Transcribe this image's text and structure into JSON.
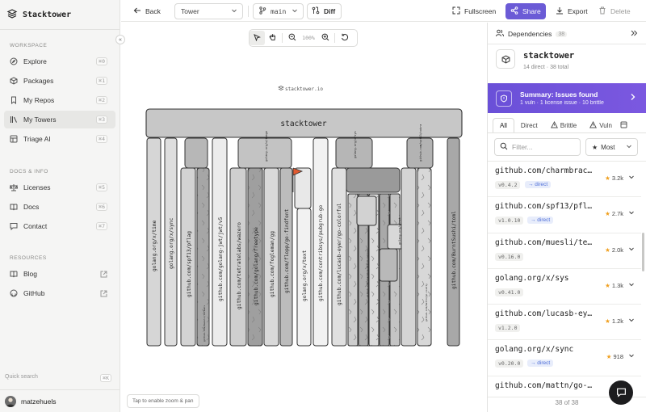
{
  "brand": {
    "name": "Stacktower"
  },
  "sidebar": {
    "sections": [
      {
        "title": "Workspace",
        "items": [
          {
            "label": "Explore",
            "kbd": "⌘0",
            "icon": "compass-icon"
          },
          {
            "label": "Packages",
            "kbd": "⌘1",
            "icon": "package-icon"
          },
          {
            "label": "My Repos",
            "kbd": "⌘2",
            "icon": "bookmark-icon"
          },
          {
            "label": "My Towers",
            "kbd": "⌘3",
            "icon": "library-icon",
            "active": true
          },
          {
            "label": "Triage AI",
            "kbd": "⌘4",
            "icon": "triage-icon"
          }
        ]
      },
      {
        "title": "Docs & Info",
        "items": [
          {
            "label": "Licenses",
            "kbd": "⌘5",
            "icon": "scale-icon"
          },
          {
            "label": "Docs",
            "kbd": "⌘6",
            "icon": "book-icon"
          },
          {
            "label": "Contact",
            "kbd": "⌘7",
            "icon": "message-icon"
          }
        ]
      },
      {
        "title": "Resources",
        "items": [
          {
            "label": "Blog",
            "icon": "blog-icon"
          },
          {
            "label": "GitHub",
            "icon": "github-icon"
          }
        ]
      }
    ],
    "quick_search": {
      "label": "Quick search",
      "kbd": "⌘K"
    },
    "user": {
      "name": "matzehuels"
    }
  },
  "topbar": {
    "back": "Back",
    "view_select": "Tower",
    "branch": "main",
    "diff": "Diff",
    "fullscreen": "Fullscreen",
    "share": "Share",
    "export": "Export",
    "delete": "Delete"
  },
  "canvas": {
    "zoom": "100%",
    "tap_hint": "Tap  to enable zoom & pan",
    "watermark": "stacktower.io",
    "root_label": "stacktower",
    "labels": [
      "golang.org/x/time",
      "golang.org/x/sync",
      "github.com/spf13/pflag",
      "github.com/muesli/termenv",
      "github.com/golang-jwt/jwt/v5",
      "github.com/tetratelabs/wazero",
      "github.com/golang/freetype",
      "github.com/fogleman/gg",
      "github.com/flopp/go-findfont",
      "golang.org/x/text",
      "github.com/contribsys/pubgrub-go",
      "github.com/lucasb-eyer/go-colorful",
      "github.com/mattn/go-isatty",
      "github.com/BurntSushi/toml",
      "golang.org/x/image",
      "golang.org/x/sys",
      "golang.org/x/net",
      "github.com/charmbracelet/lipgloss",
      "github.com/spf13/cobra"
    ]
  },
  "panel": {
    "title": "Dependencies",
    "count": "38",
    "package": {
      "name": "stacktower",
      "sub": "14 direct · 38 total"
    },
    "summary": {
      "title": "Summary: Issues found",
      "sub": "1 vuln · 1 license issue · 10 brittle"
    },
    "tabs": [
      "All",
      "Direct",
      "Brittle",
      "Vuln"
    ],
    "filter_placeholder": "Filter...",
    "sort": "Most",
    "deps": [
      {
        "name": "github.com/charmbracelet/lipgloss",
        "version": "v0.4.2",
        "tag": "→ direct",
        "stars": "3.2k"
      },
      {
        "name": "github.com/spf13/pflag",
        "version": "v1.0.10",
        "tag": "→ direct",
        "stars": "2.7k"
      },
      {
        "name": "github.com/muesli/termenv",
        "version": "v0.16.0",
        "tag": "",
        "stars": "2.0k"
      },
      {
        "name": "golang.org/x/sys",
        "version": "v0.41.0",
        "tag": "",
        "stars": "1.3k"
      },
      {
        "name": "github.com/lucasb-eyer/go-colorful",
        "version": "v1.2.0",
        "tag": "",
        "stars": "1.2k"
      },
      {
        "name": "golang.org/x/sync",
        "version": "v0.20.0",
        "tag": "→ direct",
        "stars": "918"
      },
      {
        "name": "github.com/mattn/go-isatty",
        "version": "",
        "tag": "",
        "stars": ""
      }
    ],
    "footer": "38 of 38"
  }
}
